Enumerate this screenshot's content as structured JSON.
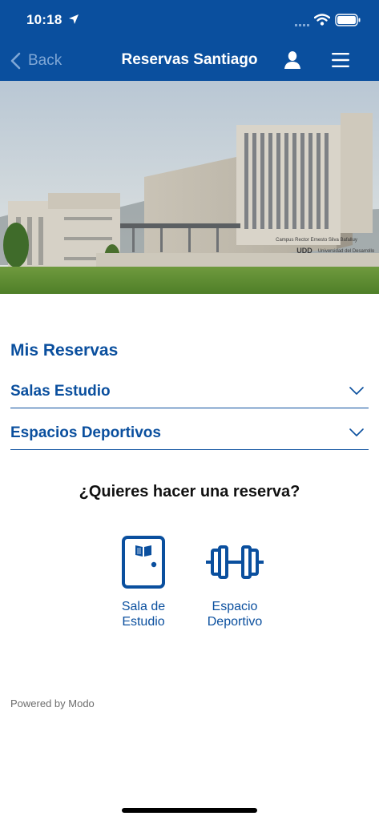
{
  "status_bar": {
    "time": "10:18"
  },
  "nav": {
    "back_label": "Back",
    "title": "Reservas Santiago"
  },
  "hero": {
    "sign_line1": "Campus Rector Ernesto Silva Bafalluy",
    "sign_line2": "Universidad del Desarrollo",
    "sign_logo": "UDD"
  },
  "reservations": {
    "title": "Mis Reservas",
    "sections": [
      {
        "label": "Salas Estudio"
      },
      {
        "label": "Espacios Deportivos"
      }
    ]
  },
  "booking": {
    "prompt": "¿Quieres hacer una reserva?",
    "options": [
      {
        "line1": "Sala de",
        "line2": "Estudio",
        "icon": "study-room-door-icon"
      },
      {
        "line1": "Espacio",
        "line2": "Deportivo",
        "icon": "dumbbell-icon"
      }
    ]
  },
  "footer": {
    "powered_by": "Powered by Modo"
  },
  "colors": {
    "brand": "#0a4f9e",
    "back_text": "#7fa7d6",
    "prompt_text": "#111111",
    "footer_text": "#6d6d6d"
  }
}
